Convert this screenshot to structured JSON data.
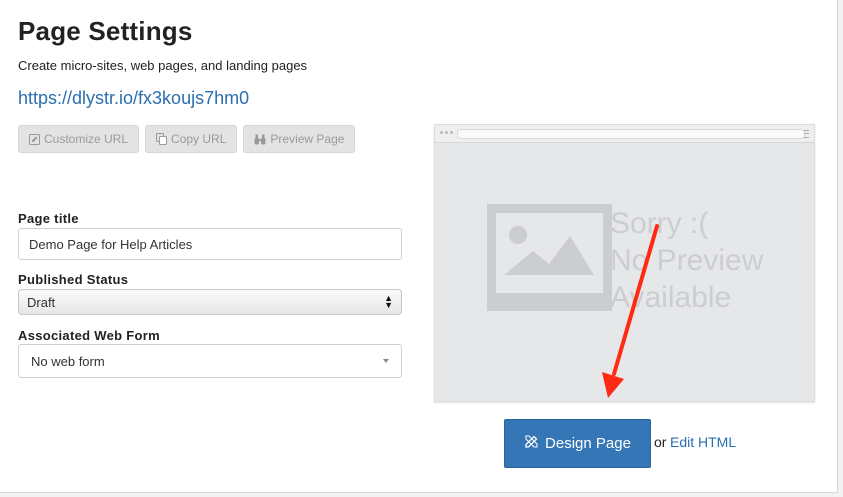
{
  "page": {
    "title": "Page Settings",
    "subtitle": "Create micro-sites, web pages, and landing pages",
    "url": "https://dlystr.io/fx3koujs7hm0"
  },
  "toolbar": {
    "customize_label": "Customize URL",
    "copy_label": "Copy URL",
    "preview_label": "Preview Page"
  },
  "form": {
    "page_title_label": "Page title",
    "page_title_value": "Demo Page for Help Articles",
    "published_label": "Published Status",
    "published_value": "Draft",
    "webform_label": "Associated Web Form",
    "webform_value": "No web form"
  },
  "preview": {
    "line1": "Sorry :(",
    "line2": "No Preview",
    "line3": "Available"
  },
  "actions": {
    "design_label": "Design Page",
    "or_text": "or",
    "edit_html_label": "Edit HTML"
  },
  "colors": {
    "primary": "#3576b6",
    "link": "#2a6fb0",
    "annotation_arrow": "#ff2a14"
  }
}
